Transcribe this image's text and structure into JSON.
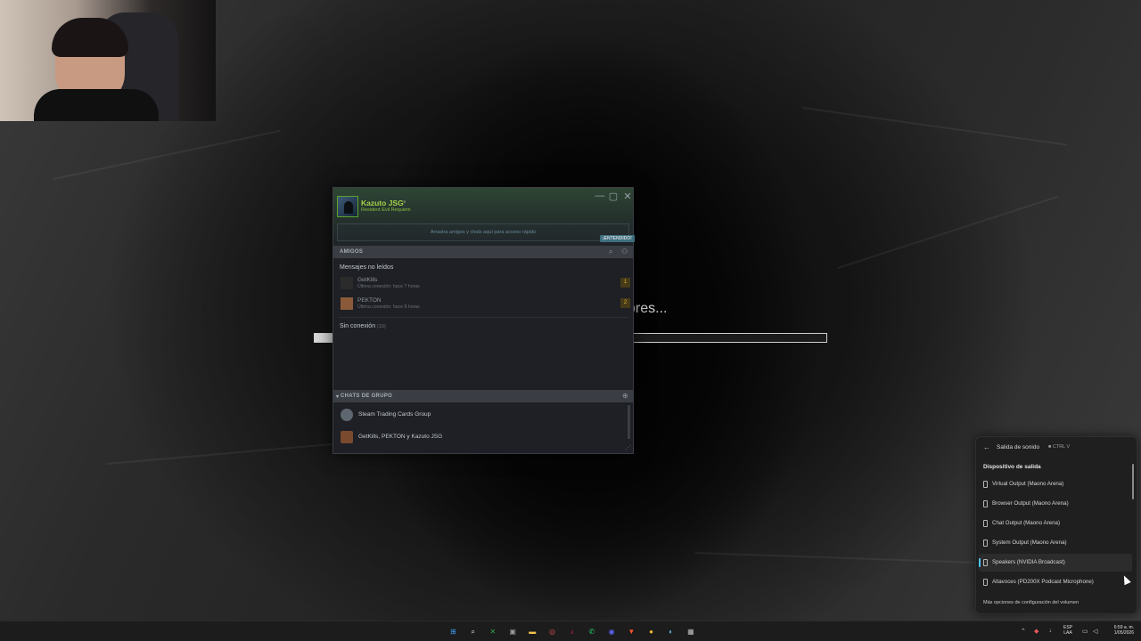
{
  "loading": {
    "text": "ores...",
    "progress_fraction": 0.04
  },
  "steam": {
    "window_controls": {
      "minimize": "—",
      "maximize": "▢",
      "close": "✕"
    },
    "user": {
      "name": "Kazuto JSG",
      "status_caret": "▾",
      "game": "Resident Evil Requiem"
    },
    "pin_hint": "Arrastra amigos y chats aquí para acceso rápido",
    "pin_button": "¡ENTENDIDO!",
    "friends_section": "AMIGOS",
    "unread_header": "Mensajes no leídos",
    "unread_friends": [
      {
        "name": "GetKills",
        "status": "Última conexión: hace 7 horas",
        "unread": "1",
        "avatar_color": "#2b2b2b"
      },
      {
        "name": "PEKTON",
        "status": "Última conexión: hace 8 horas",
        "unread": "2",
        "avatar_color": "#8a5a3a"
      }
    ],
    "offline_header": "Sin conexión",
    "offline_count": "(10)",
    "group_section": "CHATS DE GRUPO",
    "groups": [
      {
        "name": "Steam Trading Cards Group",
        "avatar_color": "#5e6770"
      },
      {
        "name": "GetKills, PEKTON y Kazuto JSG",
        "avatar_color": "#7a4a2e"
      }
    ]
  },
  "sound_panel": {
    "title": "Salida de sonido",
    "shortcut": "CTRL V",
    "subtitle": "Dispositivo de salida",
    "devices": [
      {
        "label": "Virtual Output (Maono Arena)",
        "selected": false
      },
      {
        "label": "Browser Output (Maono Arena)",
        "selected": false
      },
      {
        "label": "Chat Output (Maono Arena)",
        "selected": false
      },
      {
        "label": "System Output (Maono Arena)",
        "selected": false
      },
      {
        "label": "Speakers (NVIDIA Broadcast)",
        "selected": true
      },
      {
        "label": "Altavoces (PD200X Podcast Microphone)",
        "selected": false
      }
    ],
    "more_link": "Más opciones de configuración del volumen"
  },
  "taskbar": {
    "apps": [
      {
        "name": "start-icon",
        "glyph": "⊞",
        "color": "#3da0f5"
      },
      {
        "name": "search-icon",
        "glyph": "⌕",
        "color": "#e6e6e6"
      },
      {
        "name": "xbox-icon",
        "glyph": "✕",
        "color": "#33a852"
      },
      {
        "name": "media-icon",
        "glyph": "▣",
        "color": "#9a9a9a"
      },
      {
        "name": "file-explorer-icon",
        "glyph": "▬",
        "color": "#f2c14e"
      },
      {
        "name": "app-icon",
        "glyph": "◎",
        "color": "#d9534f"
      },
      {
        "name": "tiktok-icon",
        "glyph": "♪",
        "color": "#ee1d52"
      },
      {
        "name": "whatsapp-icon",
        "glyph": "✆",
        "color": "#25d366"
      },
      {
        "name": "discord-icon",
        "glyph": "◉",
        "color": "#5865f2"
      },
      {
        "name": "brave-icon",
        "glyph": "▼",
        "color": "#fb542b"
      },
      {
        "name": "chrome-icon",
        "glyph": "●",
        "color": "#e8b730"
      },
      {
        "name": "steam-icon",
        "glyph": "◐",
        "color": "#66c0f4"
      },
      {
        "name": "app-extra-icon",
        "glyph": "▦",
        "color": "#bdbdbd"
      }
    ],
    "tray": {
      "lang_top": "ESP",
      "lang_bottom": "LAA",
      "time": "6:59 a. m.",
      "date": "1/05/2026"
    }
  }
}
